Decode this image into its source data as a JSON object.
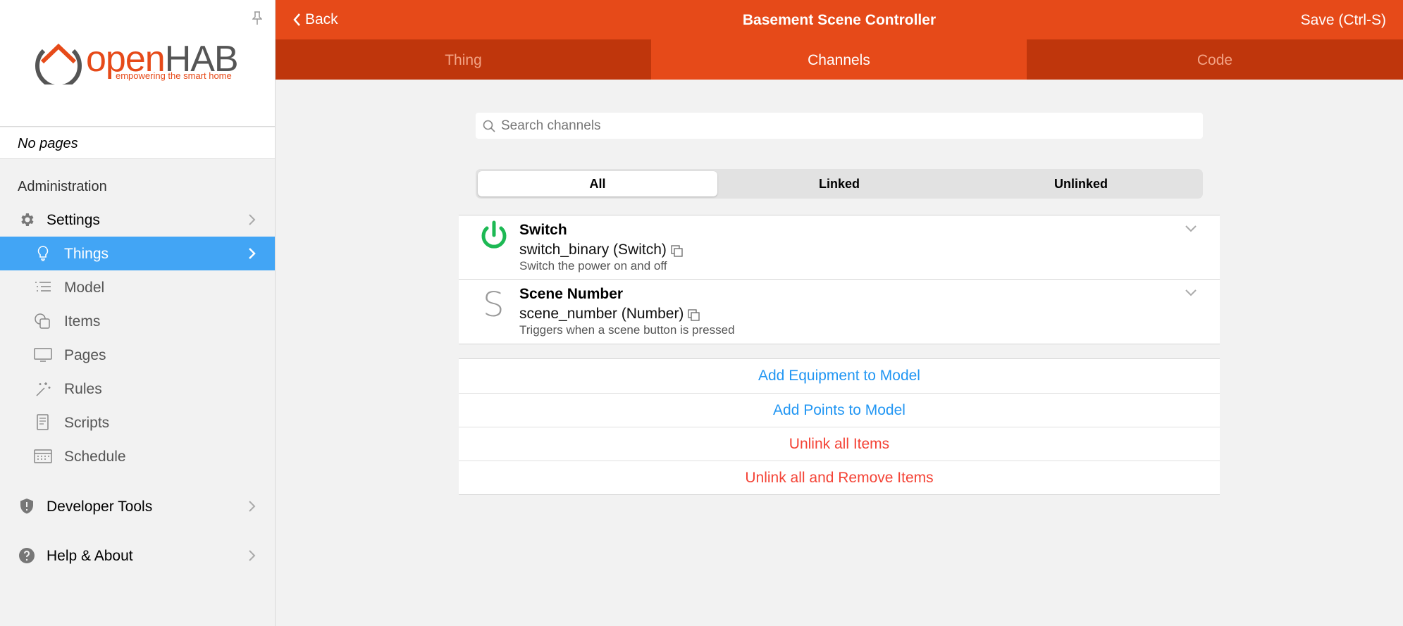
{
  "sidebar": {
    "logo": {
      "text_open": "open",
      "text_hab": "HAB",
      "tagline": "empowering the smart home"
    },
    "pages_label": "No pages",
    "section_title": "Administration",
    "settings": {
      "label": "Settings"
    },
    "sub_items": [
      {
        "label": "Things",
        "icon": "lightbulb-icon",
        "active": true
      },
      {
        "label": "Model",
        "icon": "list-icon"
      },
      {
        "label": "Items",
        "icon": "items-icon"
      },
      {
        "label": "Pages",
        "icon": "monitor-icon"
      },
      {
        "label": "Rules",
        "icon": "wand-icon"
      },
      {
        "label": "Scripts",
        "icon": "document-icon"
      },
      {
        "label": "Schedule",
        "icon": "calendar-icon"
      }
    ],
    "developer_tools": {
      "label": "Developer Tools"
    },
    "help_about": {
      "label": "Help & About"
    }
  },
  "header": {
    "back_label": "Back",
    "title": "Basement Scene Controller",
    "save_label": "Save (Ctrl-S)",
    "tabs": [
      {
        "label": "Thing"
      },
      {
        "label": "Channels",
        "active": true
      },
      {
        "label": "Code"
      }
    ]
  },
  "search": {
    "placeholder": "Search channels",
    "value": ""
  },
  "filter": {
    "options": [
      "All",
      "Linked",
      "Unlinked"
    ],
    "selected": "All"
  },
  "channels": [
    {
      "name": "Switch",
      "id": "switch_binary (Switch)",
      "description": "Switch the power on and off",
      "icon": "power-icon"
    },
    {
      "name": "Scene Number",
      "id": "scene_number (Number)",
      "description": "Triggers when a scene button is pressed",
      "letter": "S"
    }
  ],
  "actions": [
    {
      "label": "Add Equipment to Model",
      "kind": "blue"
    },
    {
      "label": "Add Points to Model",
      "kind": "blue"
    },
    {
      "label": "Unlink all Items",
      "kind": "red"
    },
    {
      "label": "Unlink all and Remove Items",
      "kind": "red"
    }
  ],
  "colors": {
    "primary": "#e64a19",
    "tab_bar": "#bf360c",
    "active_nav": "#42a5f5",
    "power_green": "#1db954",
    "link_blue": "#2196f3",
    "danger_red": "#f44336"
  }
}
